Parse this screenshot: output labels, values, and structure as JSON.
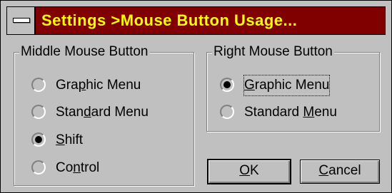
{
  "window": {
    "title": "Settings >Mouse Button Usage...",
    "system_menu_icon": "system-menu-bar-icon"
  },
  "middle_group": {
    "title": "Middle Mouse Button",
    "options": [
      {
        "label_pre": "Gra",
        "hotkey": "p",
        "label_post": "hic Menu",
        "selected": false
      },
      {
        "label_pre": "Stan",
        "hotkey": "d",
        "label_post": "ard Menu",
        "selected": false
      },
      {
        "label_pre": "",
        "hotkey": "S",
        "label_post": "hift",
        "selected": true
      },
      {
        "label_pre": "Co",
        "hotkey": "n",
        "label_post": "trol",
        "selected": false
      }
    ]
  },
  "right_group": {
    "title": "Right Mouse Button",
    "options": [
      {
        "label_pre": "",
        "hotkey": "G",
        "label_post": "raphic Menu",
        "selected": true,
        "focused": true
      },
      {
        "label_pre": "Standard ",
        "hotkey": "M",
        "label_post": "enu",
        "selected": false
      }
    ]
  },
  "buttons": {
    "ok": {
      "label_pre": "",
      "hotkey": "O",
      "label_post": "K"
    },
    "cancel": {
      "label_pre": "",
      "hotkey": "C",
      "label_post": "ancel"
    }
  },
  "colors": {
    "title_bg": "#800000",
    "title_text": "#ffff00",
    "face": "#c0c0c0"
  }
}
